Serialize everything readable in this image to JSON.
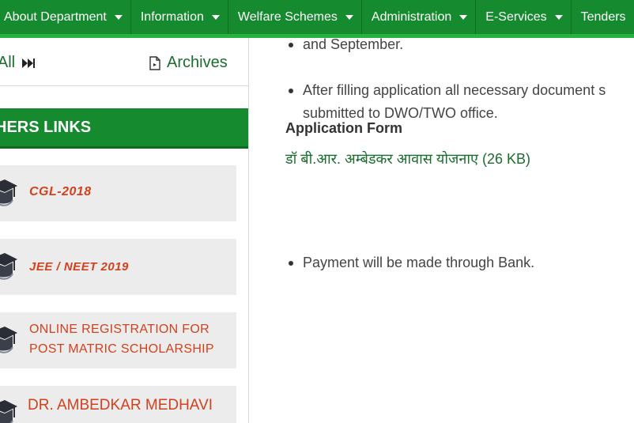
{
  "nav": {
    "items": [
      {
        "label": "About Department"
      },
      {
        "label": "Information"
      },
      {
        "label": "Welfare Schemes"
      },
      {
        "label": "Administration"
      },
      {
        "label": "E-Services"
      },
      {
        "label": "Tenders"
      }
    ]
  },
  "news": {
    "view_all_label": "w All",
    "archives_label": "Archives"
  },
  "others_links": {
    "heading": "HERS LINKS",
    "items": [
      {
        "label": "CGL-2018"
      },
      {
        "label": "JEE / NEET 2019"
      },
      {
        "line1": "ONLINE REGISTRATION FOR",
        "line2": "POST MATRIC SCHOLARSHIP"
      },
      {
        "label": "DR. AMBEDKAR MEDHAVI"
      }
    ]
  },
  "content": {
    "bullet_partial": "and September.",
    "bullet2_line1": "After filling application all necessary document s",
    "bullet2_line2": "submitted to DWO/TWO office.",
    "app_form_heading": "Application Form",
    "form_link": "डॉ बी.आर. अम्बेडकर आवास योजनाए (26 KB)",
    "bullet3": "Payment will be made through Bank."
  },
  "colors": {
    "nav_green": "#158a2e",
    "nav_border": "#23b33c",
    "link_green": "#1a6d2f",
    "card_text_red": "#d2411e",
    "card_bg": "#ececec"
  }
}
